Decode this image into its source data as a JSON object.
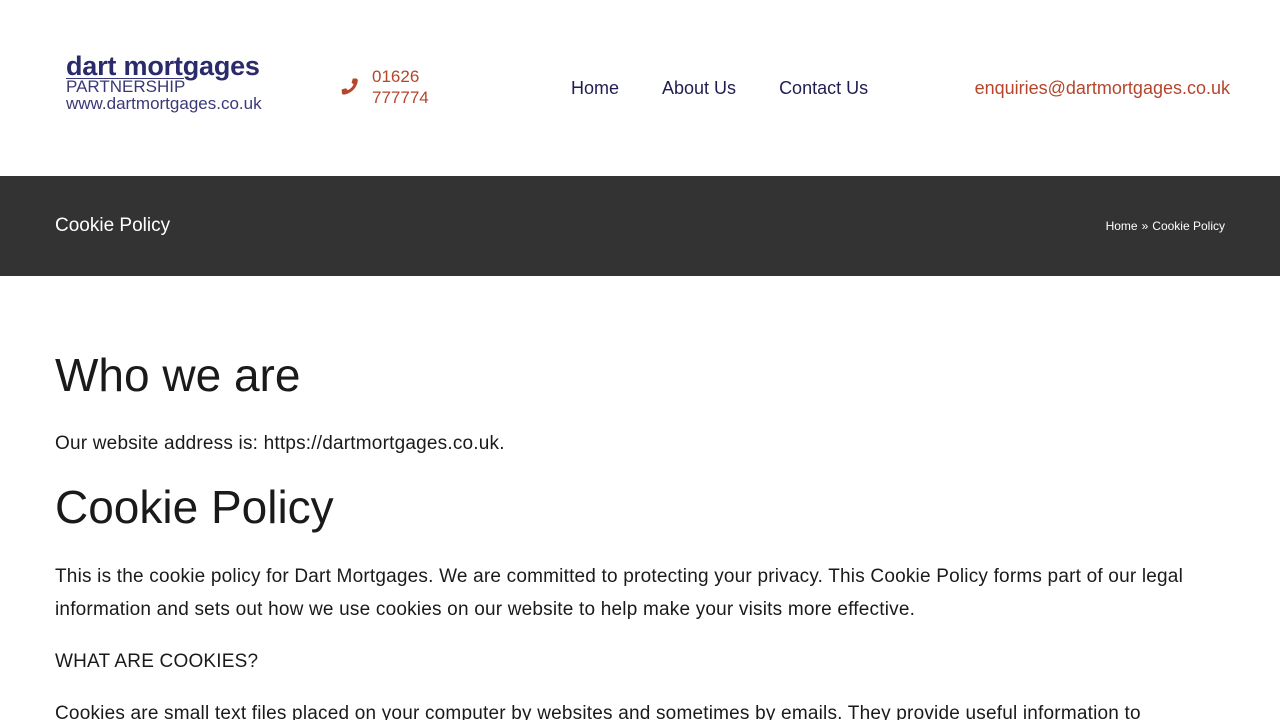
{
  "header": {
    "logo": {
      "main": "dart mortgages",
      "sub": "PARTNERSHIP",
      "url": "www.dartmortgages.co.uk"
    },
    "phone": "01626 777774",
    "phone_icon": "phone-icon",
    "nav": {
      "items": [
        {
          "label": "Home"
        },
        {
          "label": "About Us"
        },
        {
          "label": "Contact Us"
        }
      ]
    },
    "email": "enquiries@dartmortgages.co.uk"
  },
  "title_bar": {
    "title": "Cookie Policy",
    "breadcrumb": {
      "home": "Home",
      "separator": "»",
      "current": "Cookie Policy"
    }
  },
  "content": {
    "who_heading": "Who we are",
    "address_text": "Our website address is: https://dartmortgages.co.uk.",
    "cookie_heading": "Cookie Policy",
    "intro_text": "This is the cookie policy for Dart Mortgages.  We are committed to protecting your privacy. This Cookie Policy forms part of our legal information and sets out how we use cookies on our website to help make your visits more effective.",
    "what_heading": "WHAT ARE COOKIES?",
    "cookies_text": "Cookies are small text files placed on your computer by websites and sometimes by emails. They provide useful information to"
  },
  "colors": {
    "brand_navy": "#2b2a6b",
    "accent_rust": "#b5452b",
    "title_bar_bg": "#333333"
  }
}
